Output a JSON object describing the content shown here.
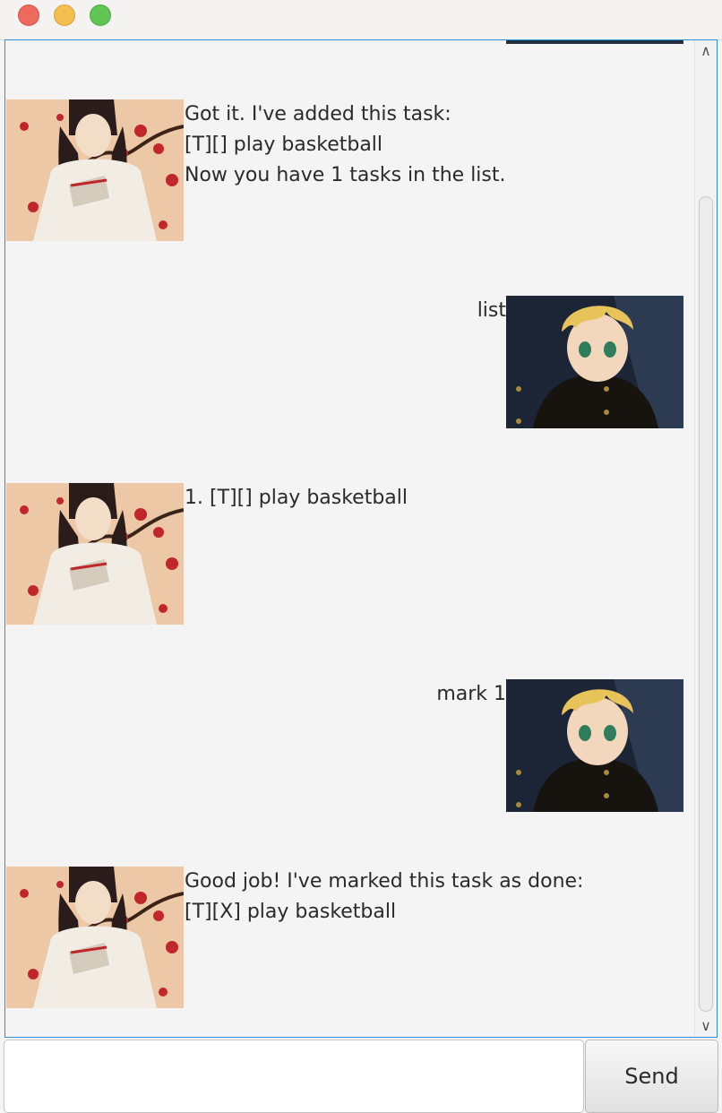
{
  "conversation": [
    {
      "speaker": "duke",
      "text": "Got it. I've added this task:\n[T][] play basketball\nNow you have 1 tasks in the list."
    },
    {
      "speaker": "user",
      "text": "list"
    },
    {
      "speaker": "duke",
      "text": "1. [T][] play basketball"
    },
    {
      "speaker": "user",
      "text": "mark 1"
    },
    {
      "speaker": "duke",
      "text": "Good job! I've marked this task as done:\n[T][X] play basketball"
    }
  ],
  "input": {
    "value": "",
    "placeholder": ""
  },
  "send_button": {
    "label": "Send"
  },
  "colors": {
    "pane_border": "#2a8fd6",
    "close": "#ec6a5e",
    "minimize": "#f4bf4f",
    "maximize": "#61c554"
  },
  "icons": {
    "scroll_up": "chevron-up-icon",
    "scroll_down": "chevron-down-icon"
  }
}
